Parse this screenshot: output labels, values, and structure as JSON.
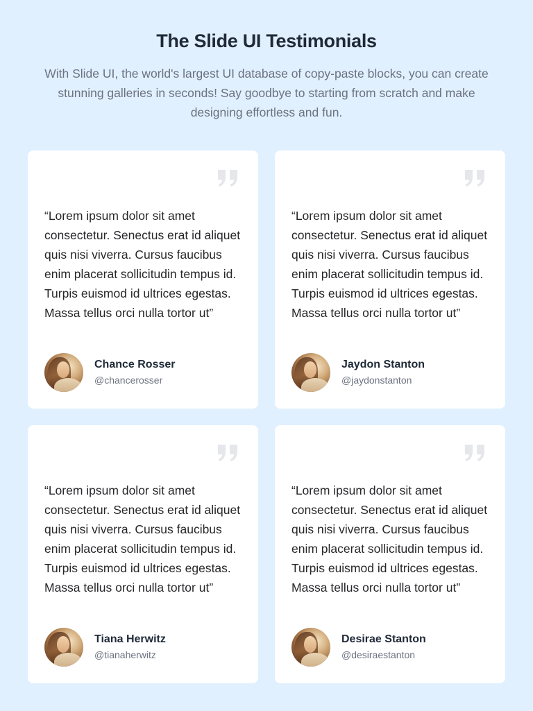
{
  "header": {
    "title": "The Slide UI Testimonials",
    "subtitle": "With Slide UI, the world's largest UI database of copy-paste blocks, you can create stunning galleries in seconds! Say goodbye to starting from scratch and make designing effortless and fun."
  },
  "testimonials": [
    {
      "quote": "“Lorem ipsum dolor sit amet consectetur. Senectus erat id aliquet quis nisi viverra. Cursus faucibus enim placerat sollicitudin tempus id. Turpis euismod id ultrices egestas. Massa tellus orci nulla tortor ut”",
      "name": "Chance Rosser",
      "handle": "@chancerosser"
    },
    {
      "quote": "“Lorem ipsum dolor sit amet consectetur. Senectus erat id aliquet quis nisi viverra. Cursus faucibus enim placerat sollicitudin tempus id. Turpis euismod id ultrices egestas. Massa tellus orci nulla tortor ut”",
      "name": "Jaydon Stanton",
      "handle": "@jaydonstanton"
    },
    {
      "quote": "“Lorem ipsum dolor sit amet consectetur. Senectus erat id aliquet quis nisi viverra. Cursus faucibus enim placerat sollicitudin tempus id. Turpis euismod id ultrices egestas. Massa tellus orci nulla tortor ut”",
      "name": "Tiana Herwitz",
      "handle": "@tianaherwitz"
    },
    {
      "quote": "“Lorem ipsum dolor sit amet consectetur. Senectus erat id aliquet quis nisi viverra. Cursus faucibus enim placerat sollicitudin tempus id. Turpis euismod id ultrices egestas. Massa tellus orci nulla tortor ut”",
      "name": "Desirae Stanton",
      "handle": "@desiraestanton"
    }
  ],
  "icons": {
    "quote": "quote-icon",
    "avatar": "avatar"
  },
  "colors": {
    "background": "#e1f0fe",
    "card": "#ffffff",
    "quote_icon": "#e5e7eb",
    "title": "#1f2937",
    "muted": "#6b7280"
  }
}
